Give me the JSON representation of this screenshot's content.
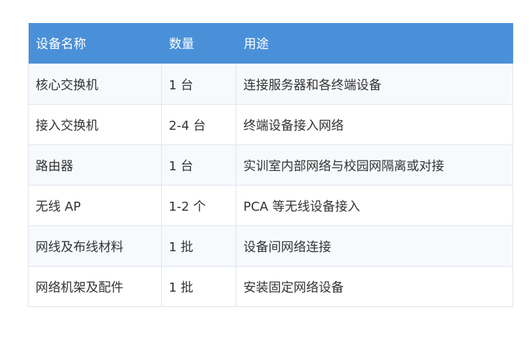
{
  "table": {
    "headers": [
      "设备名称",
      "数量",
      "用途"
    ],
    "rows": [
      [
        "核心交换机",
        "1 台",
        "连接服务器和各终端设备"
      ],
      [
        "接入交换机",
        "2-4 台",
        "终端设备接入网络"
      ],
      [
        "路由器",
        "1 台",
        "实训室内部网络与校园网隔离或对接"
      ],
      [
        "无线 AP",
        "1-2 个",
        "PCA 等无线设备接入"
      ],
      [
        "网线及布线材料",
        "1 批",
        "设备间网络连接"
      ],
      [
        "网络机架及配件",
        "1 批",
        "安装固定网络设备"
      ]
    ]
  },
  "colors": {
    "header_bg": "#4a90d9",
    "header_text": "#ffffff",
    "row_alt_bg": "#f7fafd",
    "border": "#dfe5ec"
  }
}
